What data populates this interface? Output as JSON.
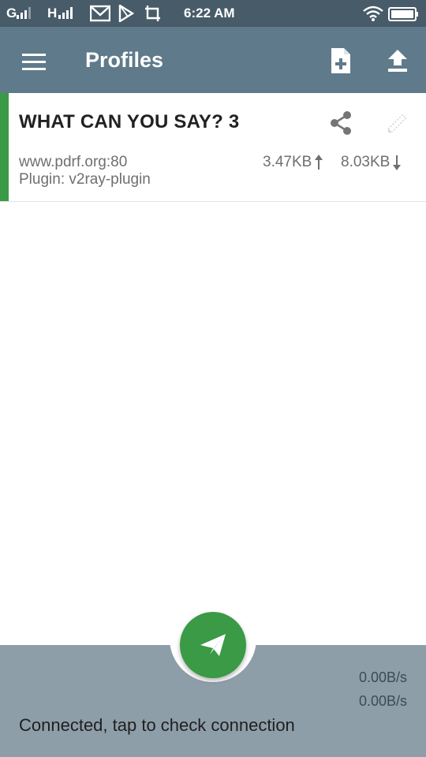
{
  "status_bar": {
    "network1": "G",
    "network2": "H",
    "time": "6:22 AM"
  },
  "app_bar": {
    "title": "Profiles",
    "icons": {
      "menu": "menu-icon",
      "add": "add-file-icon",
      "import": "upload-icon"
    }
  },
  "profile": {
    "name": "WHAT CAN YOU SAY? 3",
    "server": "www.pdrf.org:80",
    "plugin": "Plugin: v2ray-plugin",
    "tx": "3.47KB",
    "rx": "8.03KB",
    "active_color": "#3a9a46"
  },
  "bottom": {
    "tx_rate": "0.00B/s",
    "rx_rate": "0.00B/s",
    "status": "Connected, tap to check connection"
  },
  "colors": {
    "status_bar": "#485b69",
    "app_bar": "#5f7a8b",
    "bottom_bar": "#8e9ea9",
    "accent": "#3a9a46"
  }
}
